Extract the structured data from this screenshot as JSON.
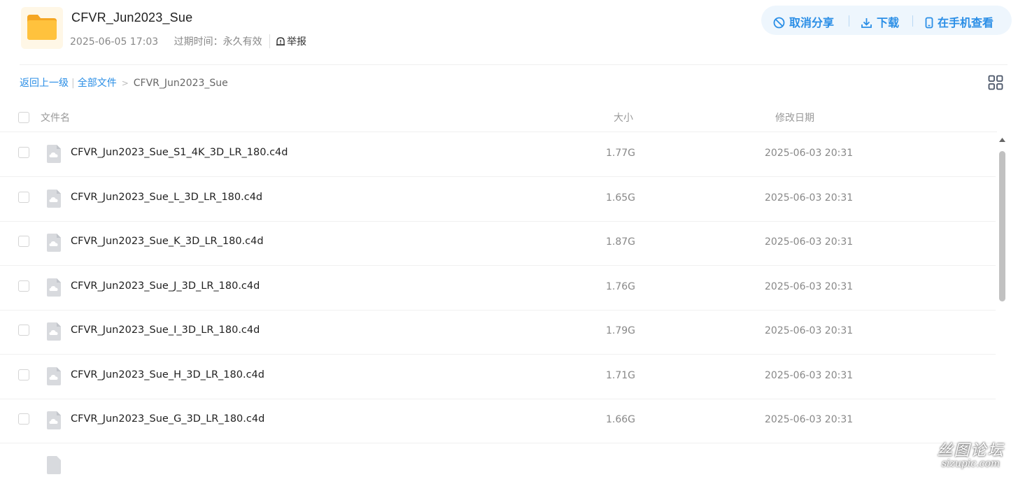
{
  "header": {
    "title": "CFVR_Jun2023_Sue",
    "date": "2025-06-05 17:03",
    "expiry": "过期时间：永久有效",
    "report_label": "举报"
  },
  "actions": {
    "cancel_share": "取消分享",
    "download": "下载",
    "view_on_phone": "在手机查看",
    "accent_color": "#2a8ee6"
  },
  "breadcrumb": {
    "back": "返回上一级",
    "all_files": "全部文件",
    "current": "CFVR_Jun2023_Sue"
  },
  "table": {
    "columns": {
      "name": "文件名",
      "size": "大小",
      "modified": "修改日期"
    },
    "rows": [
      {
        "name": "CFVR_Jun2023_Sue_S1_4K_3D_LR_180.c4d",
        "size": "1.77G",
        "modified": "2025-06-03 20:31"
      },
      {
        "name": "CFVR_Jun2023_Sue_L_3D_LR_180.c4d",
        "size": "1.65G",
        "modified": "2025-06-03 20:31"
      },
      {
        "name": "CFVR_Jun2023_Sue_K_3D_LR_180.c4d",
        "size": "1.87G",
        "modified": "2025-06-03 20:31"
      },
      {
        "name": "CFVR_Jun2023_Sue_J_3D_LR_180.c4d",
        "size": "1.76G",
        "modified": "2025-06-03 20:31"
      },
      {
        "name": "CFVR_Jun2023_Sue_I_3D_LR_180.c4d",
        "size": "1.79G",
        "modified": "2025-06-03 20:31"
      },
      {
        "name": "CFVR_Jun2023_Sue_H_3D_LR_180.c4d",
        "size": "1.71G",
        "modified": "2025-06-03 20:31"
      },
      {
        "name": "CFVR_Jun2023_Sue_G_3D_LR_180.c4d",
        "size": "1.66G",
        "modified": "2025-06-03 20:31"
      }
    ]
  },
  "watermark": {
    "logo_text": "丝图论坛",
    "domain": "sizupic.com"
  },
  "icons": {
    "folder": "folder-icon",
    "file": "cloud-file-icon",
    "cancel": "ban-icon",
    "download": "download-icon",
    "phone": "phone-icon",
    "report": "warning-bell-icon",
    "grid": "grid-view-icon"
  }
}
